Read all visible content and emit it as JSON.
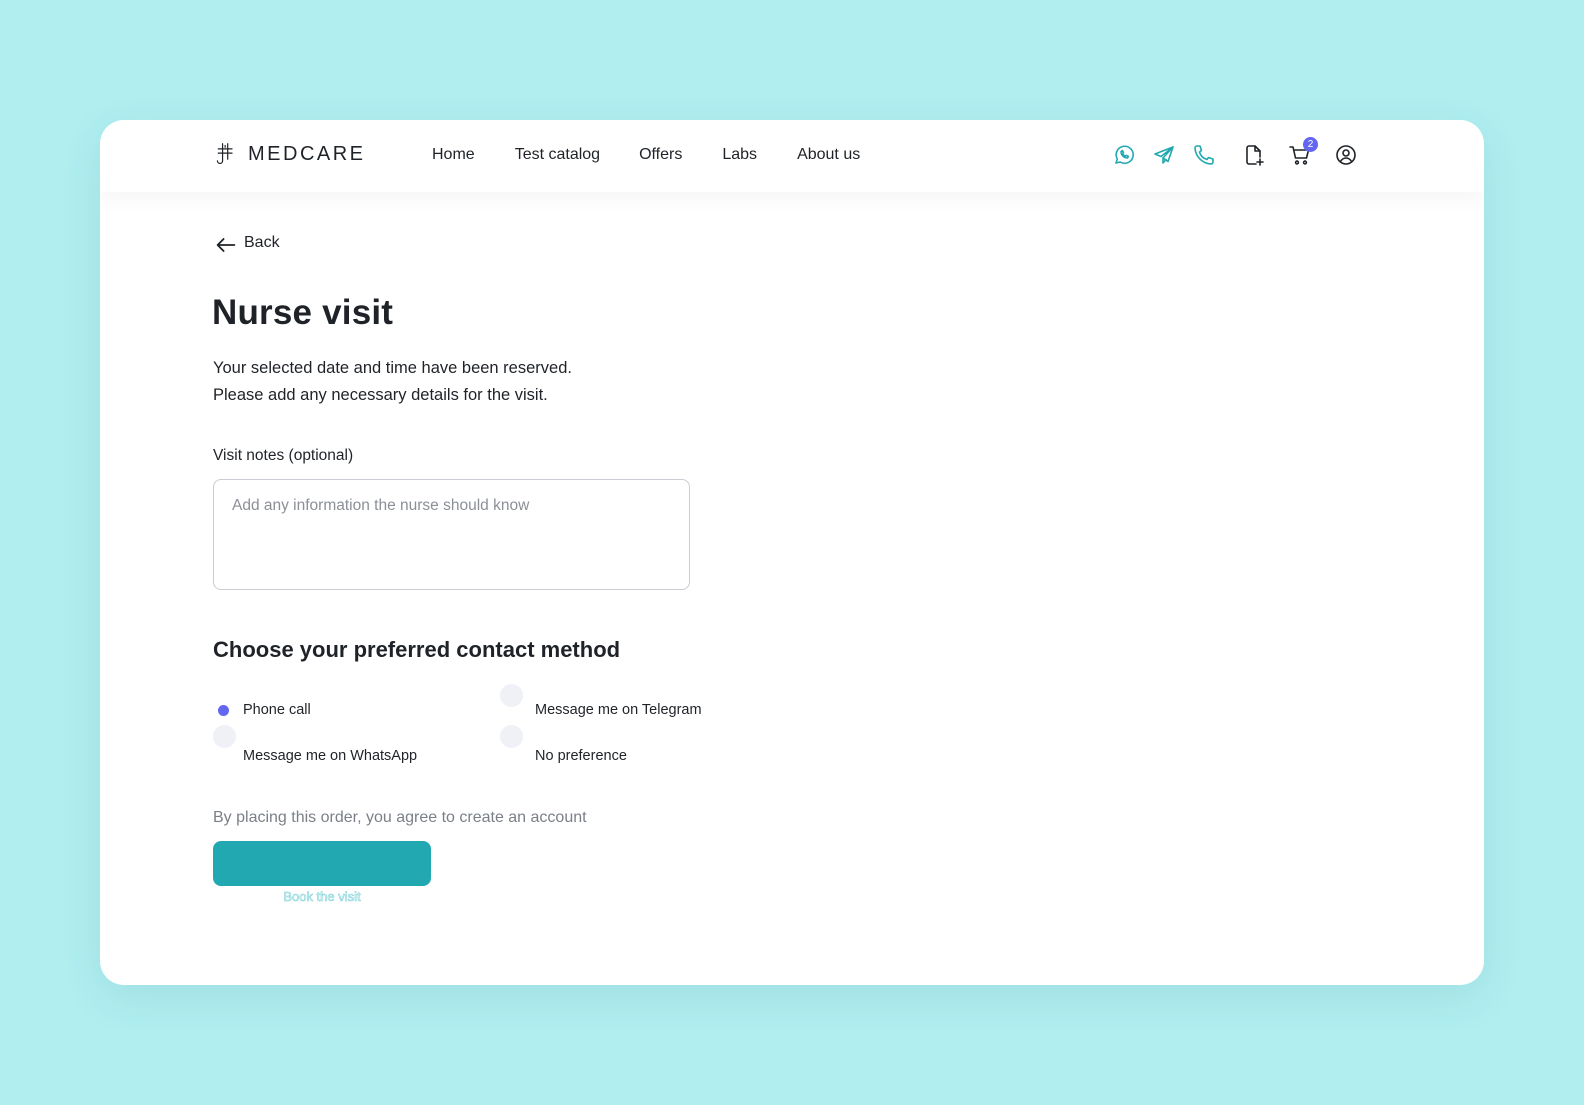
{
  "brand": {
    "name": "MEDCARE"
  },
  "nav": {
    "links": [
      "Home",
      "Test catalog",
      "Offers",
      "Labs",
      "About us"
    ]
  },
  "header_icons": {
    "contact": [
      "whatsapp-icon",
      "telegram-icon",
      "phone-icon"
    ],
    "user": [
      "add-file-icon",
      "cart-icon",
      "account-icon"
    ],
    "cart_count": "2"
  },
  "page": {
    "back_label": "Back",
    "title": "Nurse visit",
    "subtitle_line1": "Your selected date and time have been reserved.",
    "subtitle_line2": "Please add any necessary details for the visit."
  },
  "notes": {
    "label": "Visit notes (optional)",
    "placeholder": "Add any information the nurse should know",
    "value": ""
  },
  "contact": {
    "title": "Choose your preferred contact method",
    "options": [
      {
        "label": "Phone call",
        "selected": true
      },
      {
        "label": "Message me on Telegram",
        "selected": false
      },
      {
        "label": "Message me on WhatsApp",
        "selected": false
      },
      {
        "label": "No preference",
        "selected": false
      }
    ]
  },
  "footer": {
    "agree_text": "By placing this order, you agree to create an account",
    "book_label": "Book the visit"
  },
  "colors": {
    "background": "#b0eef0",
    "accent": "#21a8b0",
    "radio_selected": "#6366f1",
    "radio_unselected": "#f0f0f7"
  }
}
